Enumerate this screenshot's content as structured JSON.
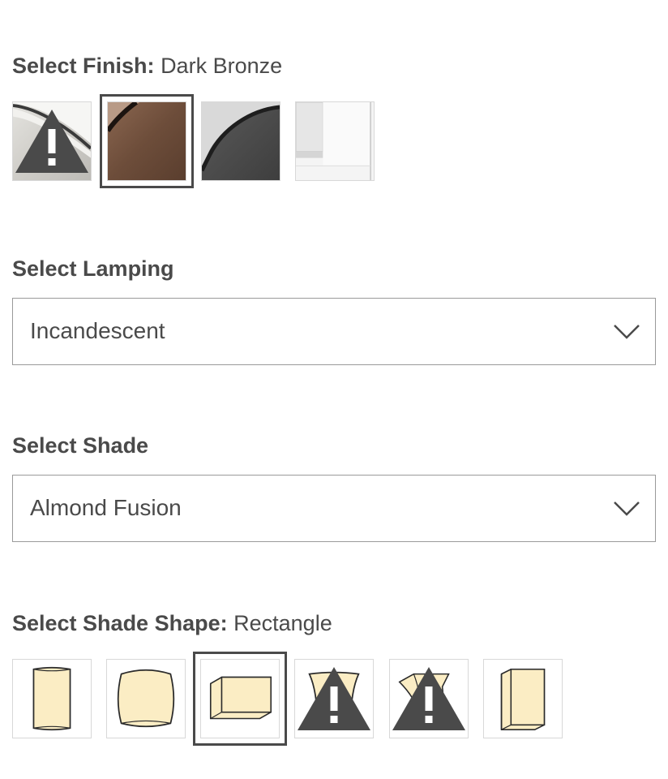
{
  "finish": {
    "label": "Select Finish:",
    "selected": "Dark Bronze",
    "options": [
      {
        "icon": "satin-nickel-swatch",
        "warning": true
      },
      {
        "icon": "dark-bronze-swatch",
        "warning": false,
        "selected": true
      },
      {
        "icon": "black-swatch",
        "warning": false
      },
      {
        "icon": "white-swatch",
        "warning": false
      }
    ]
  },
  "lamping": {
    "label": "Select Lamping",
    "value": "Incandescent"
  },
  "shade": {
    "label": "Select Shade",
    "value": "Almond Fusion"
  },
  "shade_shape": {
    "label": "Select Shade Shape:",
    "selected": "Rectangle",
    "options": [
      {
        "icon": "cylinder-shade-icon",
        "warning": false
      },
      {
        "icon": "drum-shade-icon",
        "warning": false
      },
      {
        "icon": "rectangle-shade-icon",
        "warning": false,
        "selected": true
      },
      {
        "icon": "tapered-shade-icon",
        "warning": true
      },
      {
        "icon": "flared-shade-icon",
        "warning": true
      },
      {
        "icon": "square-shade-icon",
        "warning": false
      }
    ]
  },
  "colors": {
    "text": "#4a4a4a",
    "shade_fill": "#fbedc4",
    "selected_border": "#4a4a4a",
    "swatch_border": "#d8d8d8"
  }
}
